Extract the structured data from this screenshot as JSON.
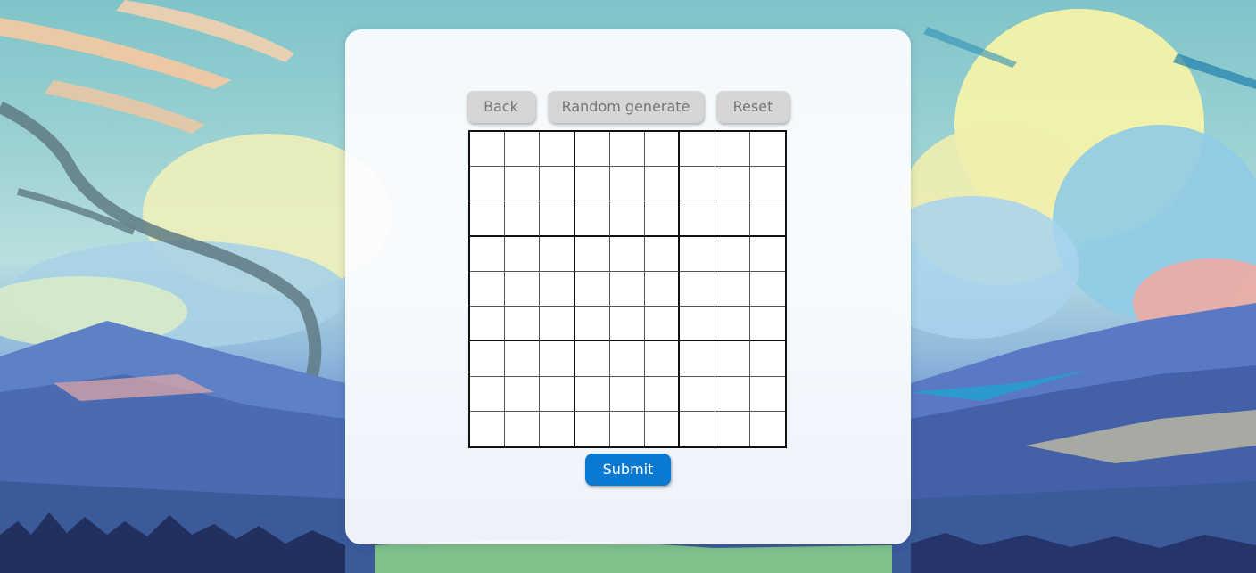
{
  "colors": {
    "panel_background": "#fcfdff",
    "secondary_button": "#d6d6d6",
    "secondary_button_text": "#757575",
    "primary_button": "#0a79d1",
    "primary_button_text": "#ffffff",
    "grid_line": "#111111"
  },
  "toolbar": {
    "back_label": "Back",
    "random_label": "Random generate",
    "reset_label": "Reset"
  },
  "board": {
    "size": 9,
    "box_size": 3,
    "cells": [
      [
        "",
        "",
        "",
        "",
        "",
        "",
        "",
        "",
        ""
      ],
      [
        "",
        "",
        "",
        "",
        "",
        "",
        "",
        "",
        ""
      ],
      [
        "",
        "",
        "",
        "",
        "",
        "",
        "",
        "",
        ""
      ],
      [
        "",
        "",
        "",
        "",
        "",
        "",
        "",
        "",
        ""
      ],
      [
        "",
        "",
        "",
        "",
        "",
        "",
        "",
        "",
        ""
      ],
      [
        "",
        "",
        "",
        "",
        "",
        "",
        "",
        "",
        ""
      ],
      [
        "",
        "",
        "",
        "",
        "",
        "",
        "",
        "",
        ""
      ],
      [
        "",
        "",
        "",
        "",
        "",
        "",
        "",
        "",
        ""
      ],
      [
        "",
        "",
        "",
        "",
        "",
        "",
        "",
        "",
        ""
      ]
    ]
  },
  "actions": {
    "submit_label": "Submit"
  }
}
